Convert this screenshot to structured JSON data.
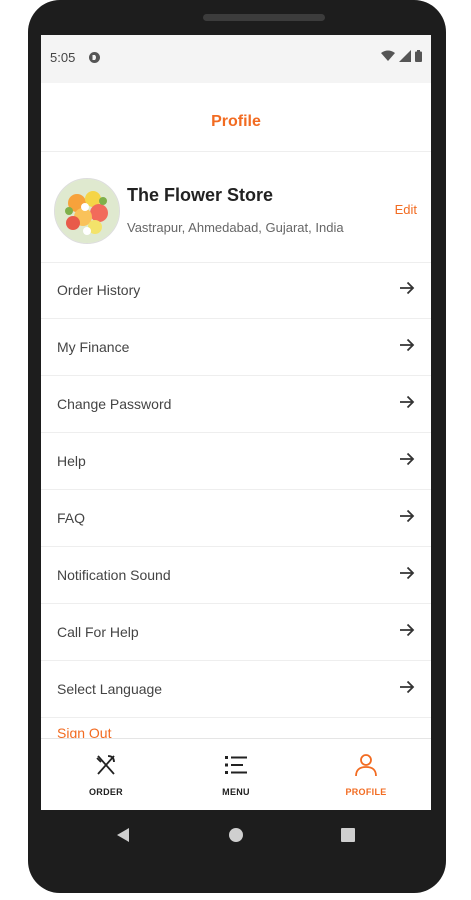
{
  "status": {
    "time": "5:05",
    "icons": [
      "app-d-icon",
      "wifi-icon",
      "signal-icon",
      "battery-icon"
    ]
  },
  "header": {
    "title": "Profile"
  },
  "profile": {
    "name": "The Flower Store",
    "address": "Vastrapur, Ahmedabad, Gujarat, India",
    "edit_label": "Edit"
  },
  "menu": {
    "items": [
      {
        "label": "Order History"
      },
      {
        "label": "My Finance"
      },
      {
        "label": "Change Password"
      },
      {
        "label": "Help"
      },
      {
        "label": "FAQ"
      },
      {
        "label": "Notification Sound"
      },
      {
        "label": "Call For Help"
      },
      {
        "label": "Select Language"
      }
    ],
    "signout_label": "Sign Out"
  },
  "bottom_nav": {
    "tabs": [
      {
        "label": "ORDER",
        "icon": "fork-knife-icon"
      },
      {
        "label": "MENU",
        "icon": "list-icon"
      },
      {
        "label": "PROFILE",
        "icon": "person-icon",
        "active": true
      }
    ]
  },
  "colors": {
    "accent": "#f26b21",
    "text": "#444444",
    "frame": "#1d1d1d"
  }
}
